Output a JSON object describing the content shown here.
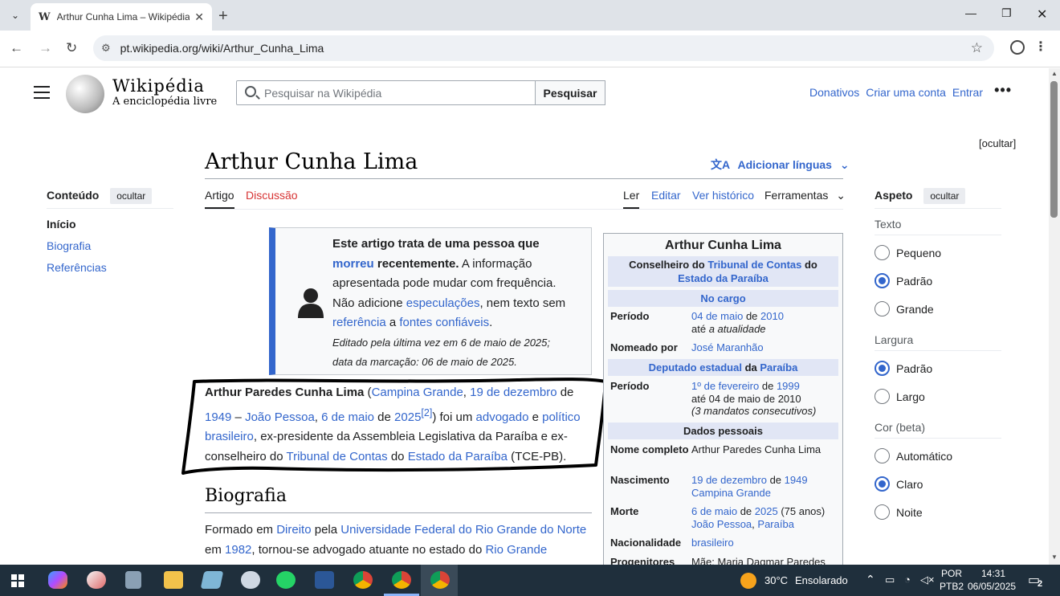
{
  "browser": {
    "tab_title": "Arthur Cunha Lima – Wikipédia",
    "favicon": "W",
    "url": "pt.wikipedia.org/wiki/Arthur_Cunha_Lima"
  },
  "header": {
    "wordmark": "Wikipédia",
    "tagline": "A enciclopédia livre",
    "search_placeholder": "Pesquisar na Wikipédia",
    "search_button": "Pesquisar",
    "donate": "Donativos",
    "create_account": "Criar uma conta",
    "login": "Entrar"
  },
  "hide_top": "[ocultar]",
  "toc": {
    "title": "Conteúdo",
    "hide": "ocultar",
    "items": [
      "Início",
      "Biografia",
      "Referências"
    ]
  },
  "page": {
    "title": "Arthur Cunha Lima",
    "add_languages": "Adicionar línguas",
    "tab_article": "Artigo",
    "tab_discussion": "Discussão",
    "view_read": "Ler",
    "view_edit": "Editar",
    "view_history": "Ver histórico",
    "tools": "Ferramentas"
  },
  "notice": {
    "bold1": "Este artigo trata de uma pessoa que ",
    "link_died": "morreu",
    "bold2": " recentemente.",
    "t1": " A informação apresentada pode mudar com frequência. Não adicione ",
    "link_spec": "especulações",
    "t2": ", nem texto sem ",
    "link_ref": "referência",
    "t3": " a ",
    "link_reliable": "fontes confiáveis",
    "t4": ".",
    "edited": "Editado pela última vez em 6 de maio de 2025;",
    "marked": "data da marcação: 06 de maio de 2025."
  },
  "lead": {
    "name": "Arthur Paredes Cunha Lima",
    "p1": " (",
    "l_campina": "Campina Grande",
    "p2": ", ",
    "l_dec19": "19 de dezembro",
    "p3": " de ",
    "l_1949": "1949",
    "p4": " – ",
    "l_jp": "João Pessoa",
    "p5": ", ",
    "l_may6": "6 de maio",
    "p6": " de ",
    "l_2025": "2025",
    "ref": "[2]",
    "p7": ") foi um ",
    "l_lawyer": "advogado",
    "p8": " e ",
    "l_pol": "político brasileiro",
    "p9": ", ex-presidente da Assembleia Legislativa da Paraíba e ex-conselheiro do ",
    "l_tc": "Tribunal de Contas",
    "p10": " do ",
    "l_state": "Estado da Paraíba",
    "p11": " (TCE-PB)."
  },
  "bio": {
    "heading": "Biografia",
    "t1": "Formado em ",
    "l_dir": "Direito",
    "t2": " pela ",
    "l_ufrn": "Universidade Federal do Rio Grande do Norte",
    "t3": " em ",
    "l_1982": "1982",
    "t4": ", tornou-se advogado atuante no estado do ",
    "l_rn": "Rio Grande"
  },
  "infobox": {
    "title": "Arthur Cunha Lima",
    "office_pre": "Conselheiro do ",
    "office_link1": "Tribunal de Contas",
    "office_mid": " do",
    "office_link2": "Estado da Paraíba",
    "in_office": "No cargo",
    "r_periodo": "Período",
    "v1_a": "04 de maio",
    "v1_b": " de ",
    "v1_c": "2010",
    "v1_d": "até ",
    "v1_e": "a atualidade",
    "r_nomeado": "Nomeado por",
    "v_nomeado": "José Maranhão",
    "band2_pre": "Deputado estadual",
    "band2_mid": " da ",
    "band2_link": "Paraíba",
    "r_periodo2": "Período",
    "v2_a": "1º de fevereiro",
    "v2_b": " de ",
    "v2_c": "1999",
    "v2_d": "até 04 de maio de 2010",
    "v2_e": "(3 mandatos consecutivos)",
    "personal": "Dados pessoais",
    "r_nome": "Nome completo",
    "v_nome": "Arthur Paredes Cunha Lima",
    "r_nasc": "Nascimento",
    "v_nasc_a": "19 de dezembro",
    "v_nasc_b": " de ",
    "v_nasc_c": "1949",
    "v_nasc_d": "Campina Grande",
    "r_morte": "Morte",
    "v_morte_a": "6 de maio",
    "v_morte_b": " de ",
    "v_morte_c": "2025",
    "v_morte_d": " (75 anos)",
    "v_morte_e": "João Pessoa",
    "v_morte_f": ", ",
    "v_morte_g": "Paraíba",
    "r_nac": "Nacionalidade",
    "v_nac": "brasileiro",
    "r_prog": "Progenitores",
    "v_prog": "Mãe: Maria Dagmar Paredes"
  },
  "aspect": {
    "title": "Aspeto",
    "hide": "ocultar",
    "text_label": "Texto",
    "text_opts": [
      "Pequeno",
      "Padrão",
      "Grande"
    ],
    "width_label": "Largura",
    "width_opts": [
      "Padrão",
      "Largo"
    ],
    "color_label": "Cor (beta)",
    "color_opts": [
      "Automático",
      "Claro",
      "Noite"
    ]
  },
  "taskbar": {
    "temp": "30°C",
    "weather": "Ensolarado",
    "lang1": "POR",
    "lang2": "PTB2",
    "time": "14:31",
    "date": "06/05/2025",
    "notif_count": "2"
  }
}
